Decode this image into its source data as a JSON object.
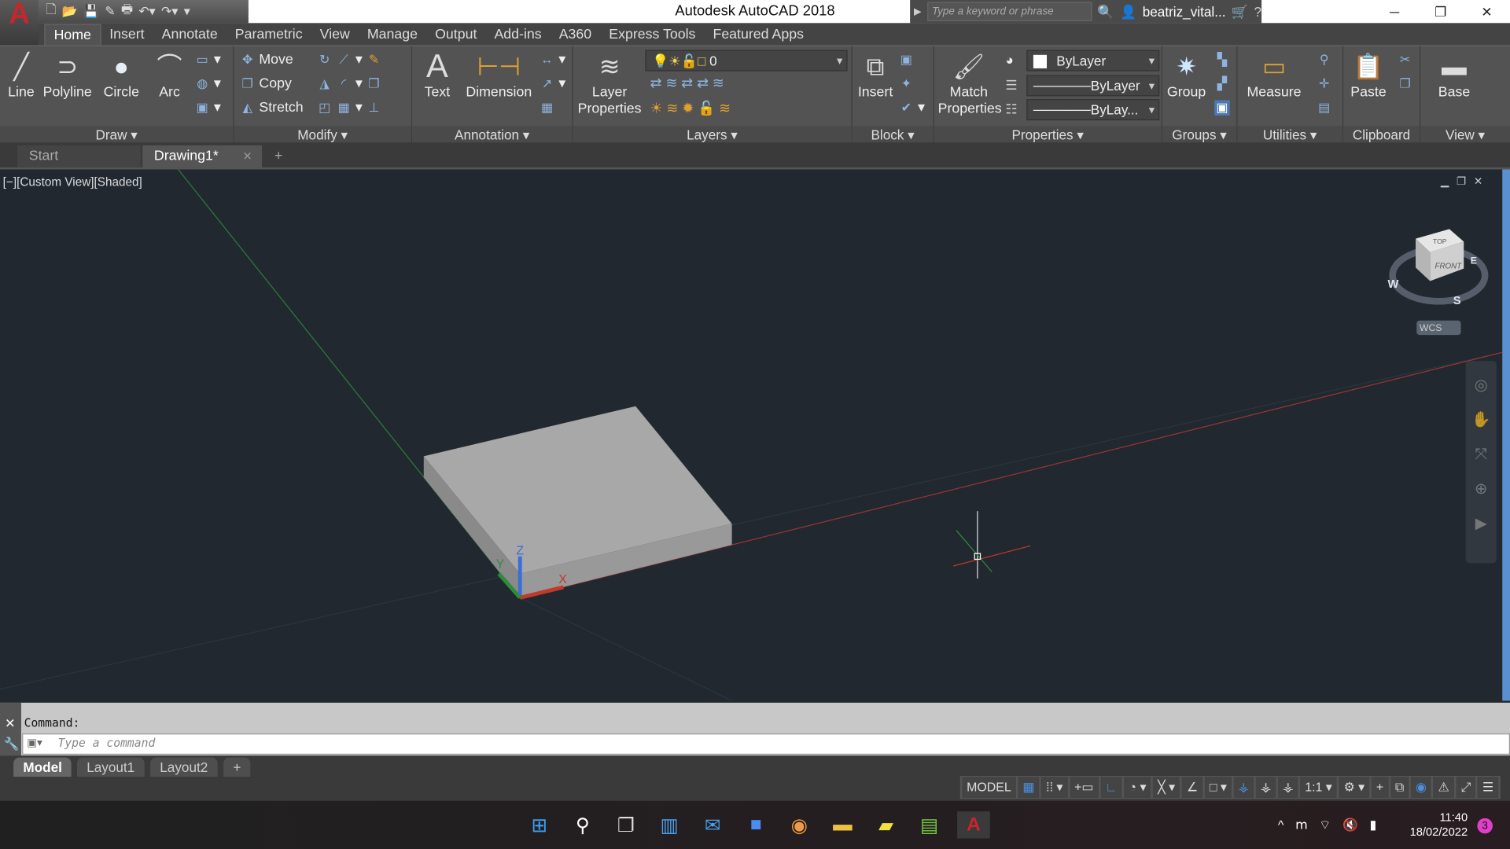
{
  "app": {
    "logo": "A",
    "title": "Autodesk AutoCAD 2018",
    "search_placeholder": "Type a keyword or phrase",
    "user": "beatriz_vital...",
    "window_controls": [
      "minimize",
      "restore",
      "close"
    ]
  },
  "qat": [
    "new-icon",
    "open-icon",
    "save-icon",
    "saveas-icon",
    "print-icon",
    "undo-icon",
    "redo-icon"
  ],
  "tabs": [
    "Home",
    "Insert",
    "Annotate",
    "Parametric",
    "View",
    "Manage",
    "Output",
    "Add-ins",
    "A360",
    "Express Tools",
    "Featured Apps"
  ],
  "ribbon": {
    "draw": {
      "label": "Draw",
      "items": [
        "Line",
        "Polyline",
        "Circle",
        "Arc"
      ]
    },
    "modify": {
      "label": "Modify",
      "items": [
        "Move",
        "Copy",
        "Stretch"
      ]
    },
    "annotation": {
      "label": "Annotation",
      "items": [
        "Text",
        "Dimension"
      ]
    },
    "layers": {
      "label": "Layers",
      "items": [
        "Layer Properties"
      ],
      "layer_value": "0"
    },
    "block": {
      "label": "Block",
      "items": [
        "Insert"
      ]
    },
    "properties": {
      "label": "Properties",
      "items": [
        "Match Properties"
      ],
      "color": "ByLayer",
      "linetype": "ByLayer",
      "lineweight": "ByLay..."
    },
    "groups": {
      "label": "Groups",
      "items": [
        "Group"
      ]
    },
    "utilities": {
      "label": "Utilities",
      "items": [
        "Measure"
      ]
    },
    "clipboard": {
      "label": "Clipboard",
      "items": [
        "Paste"
      ]
    },
    "view": {
      "label": "View",
      "items": [
        "Base"
      ]
    }
  },
  "doc_tabs": [
    "Start",
    "Drawing1*"
  ],
  "viewport": {
    "label": "[−][Custom View][Shaded]",
    "viewcube": {
      "top": "TOP",
      "front": "FRONT",
      "compass": [
        "W",
        "S",
        "E"
      ],
      "wcs": "WCS"
    },
    "ucs": {
      "x": "X",
      "y": "Y",
      "z": "Z"
    },
    "colors": {
      "background": "#212830",
      "solid": "#a9a9a9",
      "x_axis": "#c0392b",
      "y_axis": "#2e8b3a",
      "z_axis": "#3a6fd8"
    }
  },
  "command": {
    "history": "Command:",
    "placeholder": "Type a command"
  },
  "layout_tabs": [
    "Model",
    "Layout1",
    "Layout2"
  ],
  "status": {
    "model": "MODEL",
    "scale": "1:1"
  },
  "taskbar": {
    "time": "11:40",
    "date": "18/02/2022",
    "notifications": "3"
  }
}
